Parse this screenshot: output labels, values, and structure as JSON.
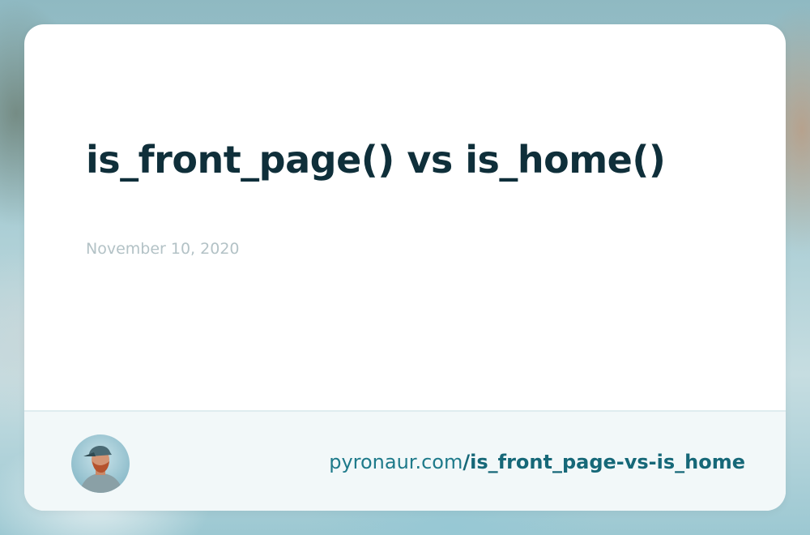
{
  "post": {
    "title": "is_front_page() vs is_home()",
    "date": "November 10, 2020"
  },
  "footer": {
    "domain": "pyronaur.com",
    "slug": "/is_front_page-vs-is_home",
    "avatar_icon": "author-avatar"
  },
  "colors": {
    "title": "#0f2f3a",
    "date": "#b3c2c6",
    "url": "#1e7a8a",
    "footer_bg": "#f2f8f9"
  }
}
